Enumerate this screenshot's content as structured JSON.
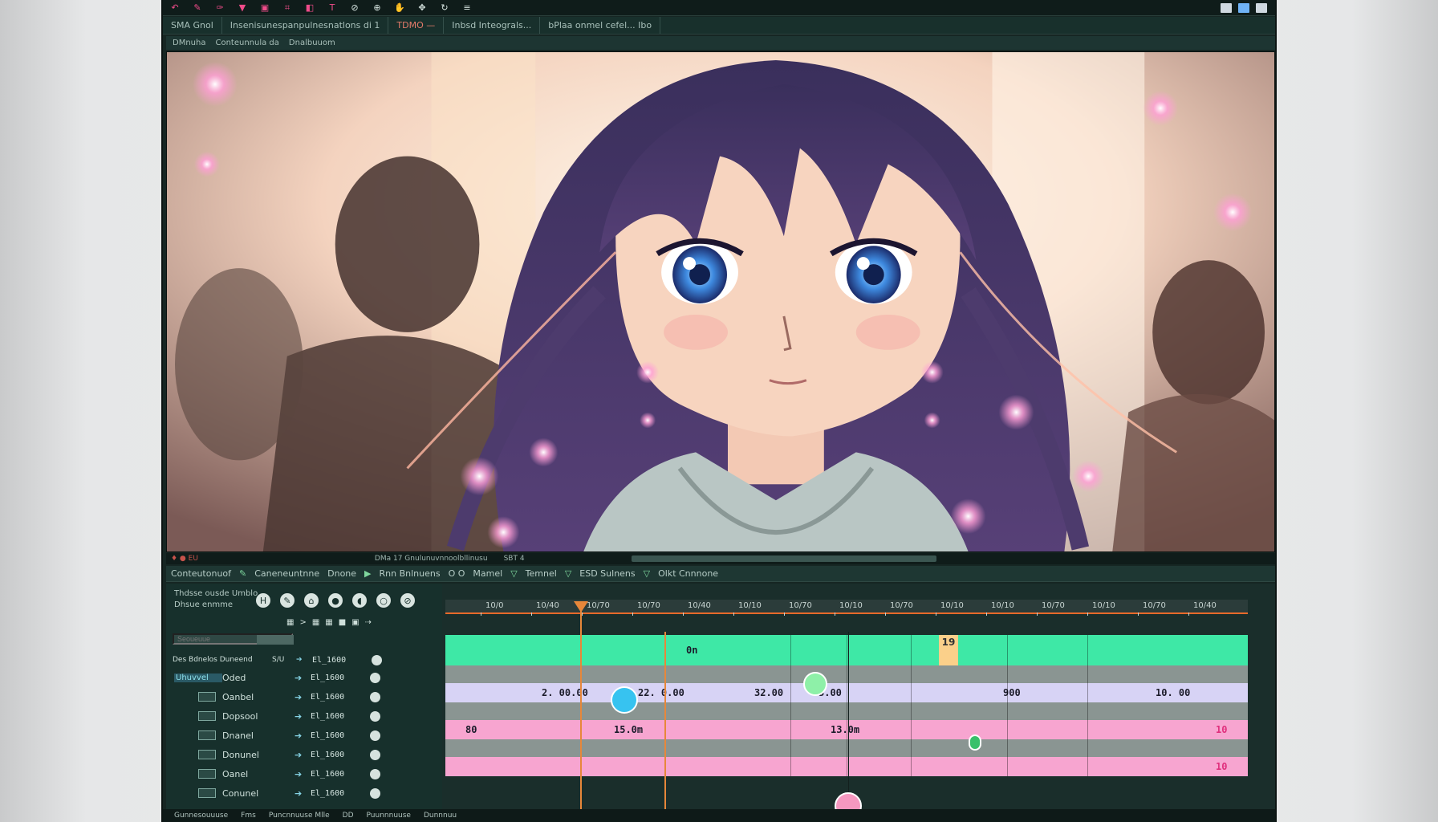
{
  "toolbar": {
    "icons": [
      "undo-icon",
      "brush-icon",
      "pen-icon",
      "fill-icon",
      "select-icon",
      "crop-icon",
      "eraser-icon",
      "text-icon",
      "eyedropper-icon",
      "zoom-icon",
      "hand-icon",
      "move-icon",
      "rotate-icon",
      "layers-icon"
    ],
    "window_controls": [
      "minimize-icon",
      "maximize-icon",
      "close-icon"
    ]
  },
  "doc_tabs": [
    "SMA Gnol",
    "Insenisunespanpulnesnatlons di 1",
    "TDMO —",
    "Inbsd Inteograls...",
    "bPlaa onmel cefel... Ibo"
  ],
  "path_bar": {
    "items": [
      "DMnuha",
      "Conteunnula da",
      "Dnalbuuom"
    ]
  },
  "viewer_status": {
    "left": "♦ ● EU",
    "center": "DMa 17 Gnulunuvnnoolbllinusu",
    "right": "SBT 4"
  },
  "panel_bar": {
    "items": [
      "Conteutonuof",
      "Caneneuntnne",
      "Dnone",
      "Rnn Bnlnuens",
      "O O",
      "Mamel",
      "Temnel",
      "ESD Sulnens",
      "Olkt Cnnnone"
    ]
  },
  "layers_panel": {
    "title": "Thdsse ousde Umblo",
    "subtitle": "Dhsue enmme",
    "search_placeholder": "Seoueuue",
    "header_row": {
      "label": "Des Bdnelos Duneend",
      "value": "S/U"
    },
    "rows": [
      {
        "name": "Oded",
        "value": "El_1600"
      },
      {
        "name": "Oanbel",
        "value": "El_1600"
      },
      {
        "name": "Dopsool",
        "value": "El_1600"
      },
      {
        "name": "Dnanel",
        "value": "El_1600"
      },
      {
        "name": "Donunel",
        "value": "El_1600"
      },
      {
        "name": "Oanel",
        "value": "El_1600"
      },
      {
        "name": "Conunel",
        "value": "El_1600"
      }
    ],
    "first_value": "El_1600",
    "first_tag": "Uhuvvel"
  },
  "timeline": {
    "ruler_ticks": [
      "10/0",
      "10/40",
      "10/70",
      "10/70",
      "10/40",
      "10/10",
      "10/70",
      "10/10",
      "10/70",
      "10/10",
      "10/10",
      "10/70",
      "10/10",
      "10/70",
      "10/40"
    ],
    "tracks": [
      {
        "color": "#3ee8a6",
        "labels": [
          {
            "text": "0n",
            "pos": 0.3
          }
        ],
        "badge": "19"
      },
      {
        "color": "#8a9592",
        "labels": []
      },
      {
        "color": "#d7d3f5",
        "labels": [
          {
            "text": "2. 00.00",
            "pos": 0.12
          },
          {
            "text": "22. 0.00",
            "pos": 0.24
          },
          {
            "text": "32.00",
            "pos": 0.385
          },
          {
            "text": "3.00",
            "pos": 0.465
          },
          {
            "text": "900",
            "pos": 0.695
          },
          {
            "text": "10. 00",
            "pos": 0.885
          }
        ]
      },
      {
        "color": "#8a9592",
        "labels": []
      },
      {
        "color": "#f7a5d0",
        "labels": [
          {
            "text": "80",
            "pos": 0.025
          },
          {
            "text": "15.0m",
            "pos": 0.21
          },
          {
            "text": "13.0m",
            "pos": 0.48
          },
          {
            "text": "10",
            "pos": 0.96
          }
        ]
      },
      {
        "color": "#8a9592",
        "labels": []
      },
      {
        "color": "#f7a5d0",
        "labels": [
          {
            "text": "10",
            "pos": 0.96
          }
        ]
      }
    ]
  },
  "statusbar": {
    "items": [
      "Gunnesouuuse",
      "Fms",
      "Puncnnuuse Mlle",
      "DD",
      "Puunnnuuse",
      "Dunnnuu"
    ]
  },
  "colors": {
    "accent_orange": "#e7873a",
    "keyframe_blue": "#37c3f0",
    "keyframe_green": "#8ef0a8",
    "keyframe_pink": "#f598c0"
  }
}
